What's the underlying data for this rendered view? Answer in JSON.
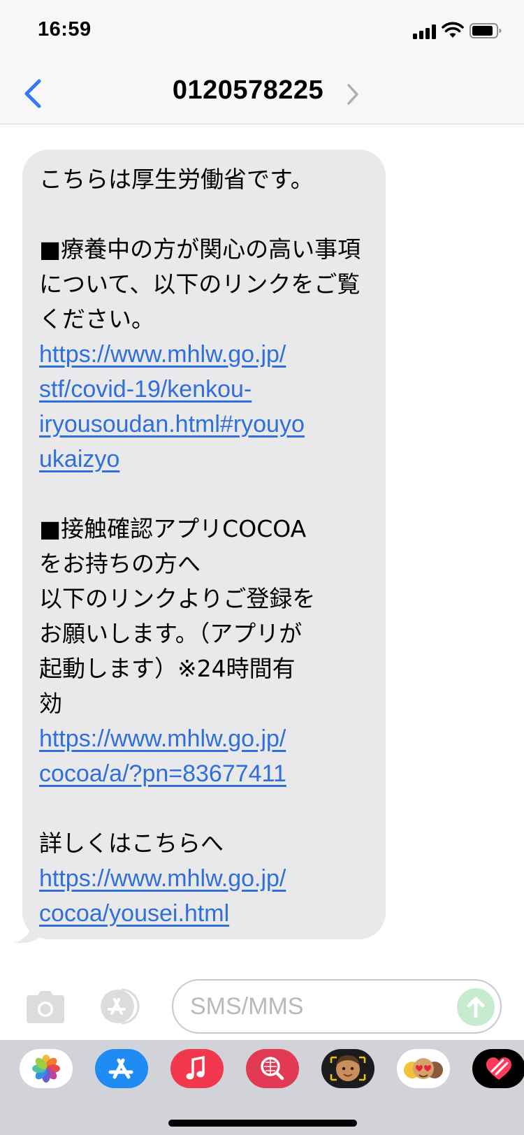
{
  "status_bar": {
    "time": "16:59",
    "icons": [
      "cellular-signal-icon",
      "wifi-icon",
      "battery-icon"
    ]
  },
  "nav": {
    "back_icon": "chevron-left-icon",
    "title": "0120578225",
    "detail_icon": "chevron-right-icon"
  },
  "message": {
    "p1": "こちらは厚生労働省です。",
    "p2": "■療養中の方が関心の高い事項について、以下のリンクをご覧ください。",
    "link1_lines": [
      "https://www.mhlw.go.jp/",
      "stf/covid-19/kenkou-",
      "iryousoudan.html#ryouyo",
      "ukaizyo"
    ],
    "p3_lines": [
      "■接触確認アプリCOCOA",
      "をお持ちの方へ",
      "以下のリンクよりご登録を",
      "お願いします。（アプリが",
      "起動します）※24時間有",
      "効"
    ],
    "link2_lines": [
      "https://www.mhlw.go.jp/",
      "cocoa/a/?pn=83677411"
    ],
    "p4": "詳しくはこちらへ",
    "link3_lines": [
      "https://www.mhlw.go.jp/",
      "cocoa/yousei.html"
    ]
  },
  "input_bar": {
    "placeholder": "SMS/MMS",
    "camera_icon": "camera-icon",
    "apps_icon": "app-store-icon",
    "send_icon": "arrow-up-icon"
  },
  "app_drawer": [
    "photos-icon",
    "app-store-icon",
    "music-icon",
    "web-search-icon",
    "memoji-icon",
    "animoji-icon",
    "digital-touch-icon"
  ],
  "colors": {
    "link": "#2e6fdc",
    "bubble": "#e9e9eb",
    "accent": "#3478f6"
  }
}
